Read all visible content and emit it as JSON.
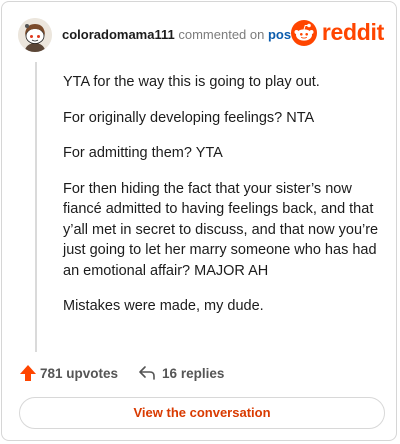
{
  "header": {
    "username": "coloradomama111",
    "verb": "commented on",
    "post_link": "post",
    "brand_word": "reddit"
  },
  "comment": {
    "paragraphs": [
      "YTA for the way this is going to play out.",
      "For originally developing feelings? NTA",
      "For admitting them? YTA",
      "For then hiding the fact that your sister’s now fiancé admitted to having feelings back, and that y’all met in secret to discuss, and that now you’re just going to let her marry someone who has had an emotional affair? MAJOR AH",
      "Mistakes were made, my dude."
    ]
  },
  "actions": {
    "upvotes": "781 upvotes",
    "replies": "16 replies"
  },
  "cta": {
    "label": "View the conversation"
  },
  "colors": {
    "brand": "#ff4500",
    "upvote": "#ff4500",
    "cta_text": "#d93a00",
    "link": "#0b5cad"
  },
  "icons": [
    "avatar",
    "reddit-logo-icon",
    "upvote-arrow-icon",
    "reply-arrow-icon"
  ]
}
